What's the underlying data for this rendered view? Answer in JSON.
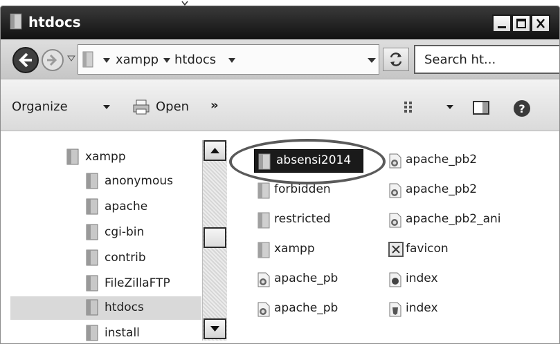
{
  "window": {
    "title": "htdocs"
  },
  "window_buttons": {
    "minimize": "minimize",
    "maximize": "maximize",
    "close": "close"
  },
  "address": {
    "crumbs": [
      "xampp",
      "htdocs"
    ],
    "search_placeholder": "Search ht..."
  },
  "command_bar": {
    "organize": "Organize",
    "open": "Open",
    "more": "»"
  },
  "nav_tree": {
    "root": "xampp",
    "items": [
      "anonymous",
      "apache",
      "cgi-bin",
      "contrib",
      "FileZillaFTP",
      "htdocs",
      "install"
    ],
    "selected": "htdocs"
  },
  "files": {
    "col1": [
      {
        "name": "absensi2014",
        "icon": "folder-icon"
      },
      {
        "name": "forbidden",
        "icon": "folder-icon"
      },
      {
        "name": "restricted",
        "icon": "folder-icon"
      },
      {
        "name": "xampp",
        "icon": "folder-icon"
      },
      {
        "name": "apache_pb",
        "icon": "apache-image-icon"
      },
      {
        "name": "apache_pb",
        "icon": "apache-image-icon"
      }
    ],
    "col2": [
      {
        "name": "apache_pb2",
        "icon": "apache-image-icon"
      },
      {
        "name": "apache_pb2",
        "icon": "apache-image-icon"
      },
      {
        "name": "apache_pb2_ani",
        "icon": "apache-image-icon"
      },
      {
        "name": "favicon",
        "icon": "favicon-icon"
      },
      {
        "name": "index",
        "icon": "php-file-icon"
      },
      {
        "name": "index",
        "icon": "html-file-icon"
      }
    ],
    "selected": "absensi2014"
  }
}
